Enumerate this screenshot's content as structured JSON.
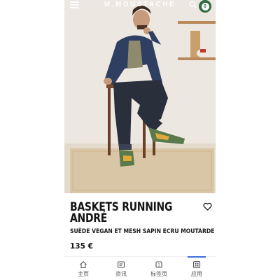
{
  "header": {
    "brand": "M.MOUSTACHE",
    "menu_icon": "hamburger-menu-icon",
    "search_icon": "search-icon",
    "cart_icon": "cart-badge-icon"
  },
  "product": {
    "title_line1": "BASKETS RUNNING",
    "title_line2": "ANDRÉ",
    "subtitle": "SUÈDE VEGAN ET MESH SAPIN ECRU MOUTARDE",
    "price": "135 €"
  },
  "tabbar": {
    "items": [
      {
        "label": "主页",
        "icon": "home-icon"
      },
      {
        "label": "资讯",
        "icon": "news-icon"
      },
      {
        "label": "标签页",
        "icon": "tabs-icon"
      },
      {
        "label": "应用",
        "icon": "apps-icon"
      }
    ],
    "active_index": 3
  },
  "colors": {
    "accent": "#3d6fe0",
    "brand_green": "#2f6b3e",
    "text": "#141414"
  }
}
